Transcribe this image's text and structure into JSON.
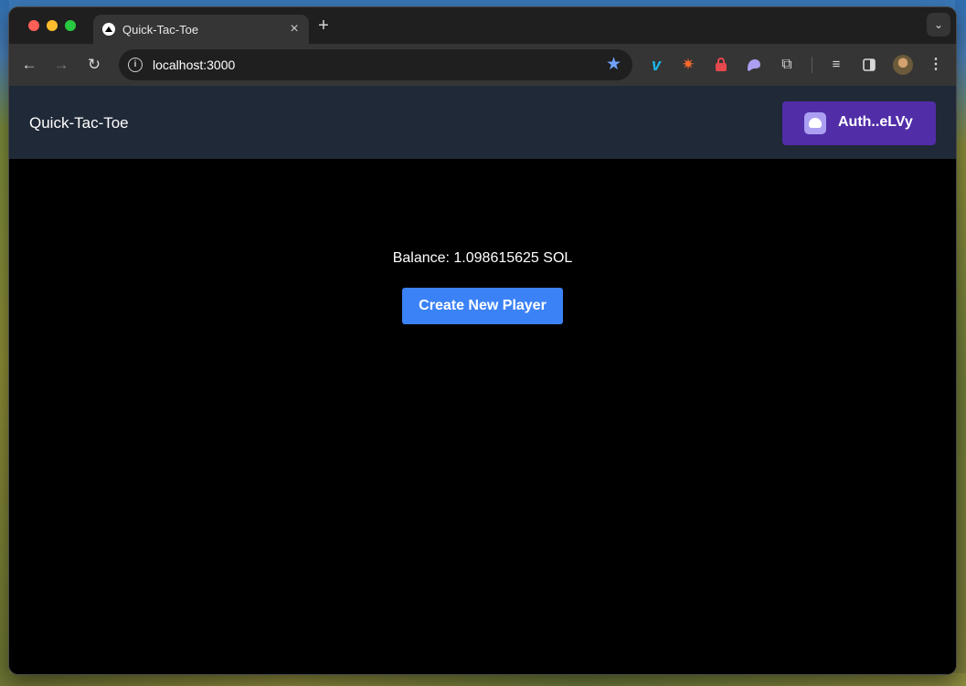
{
  "browser": {
    "tab_title": "Quick-Tac-Toe",
    "tab_close": "×",
    "new_tab": "+",
    "url_host": "localhost:3000",
    "icons": [
      "back-icon",
      "forward-icon",
      "reload-icon",
      "info-icon",
      "star-icon",
      "vimeo-extension-icon",
      "burst-extension-icon",
      "lock-extension-icon",
      "phantom-extension-icon",
      "puzzle-extension-icon",
      "reading-list-icon",
      "side-panel-icon",
      "profile-avatar",
      "menu-icon"
    ]
  },
  "app": {
    "title": "Quick-Tac-Toe",
    "wallet_label": "Auth..eLVy",
    "balance_text": "Balance: 1.098615625 SOL",
    "create_player_label": "Create New Player"
  },
  "colors": {
    "header_bg": "#1f2937",
    "wallet_bg": "#512da8",
    "primary_button": "#3b82f6",
    "page_bg": "#000000"
  }
}
